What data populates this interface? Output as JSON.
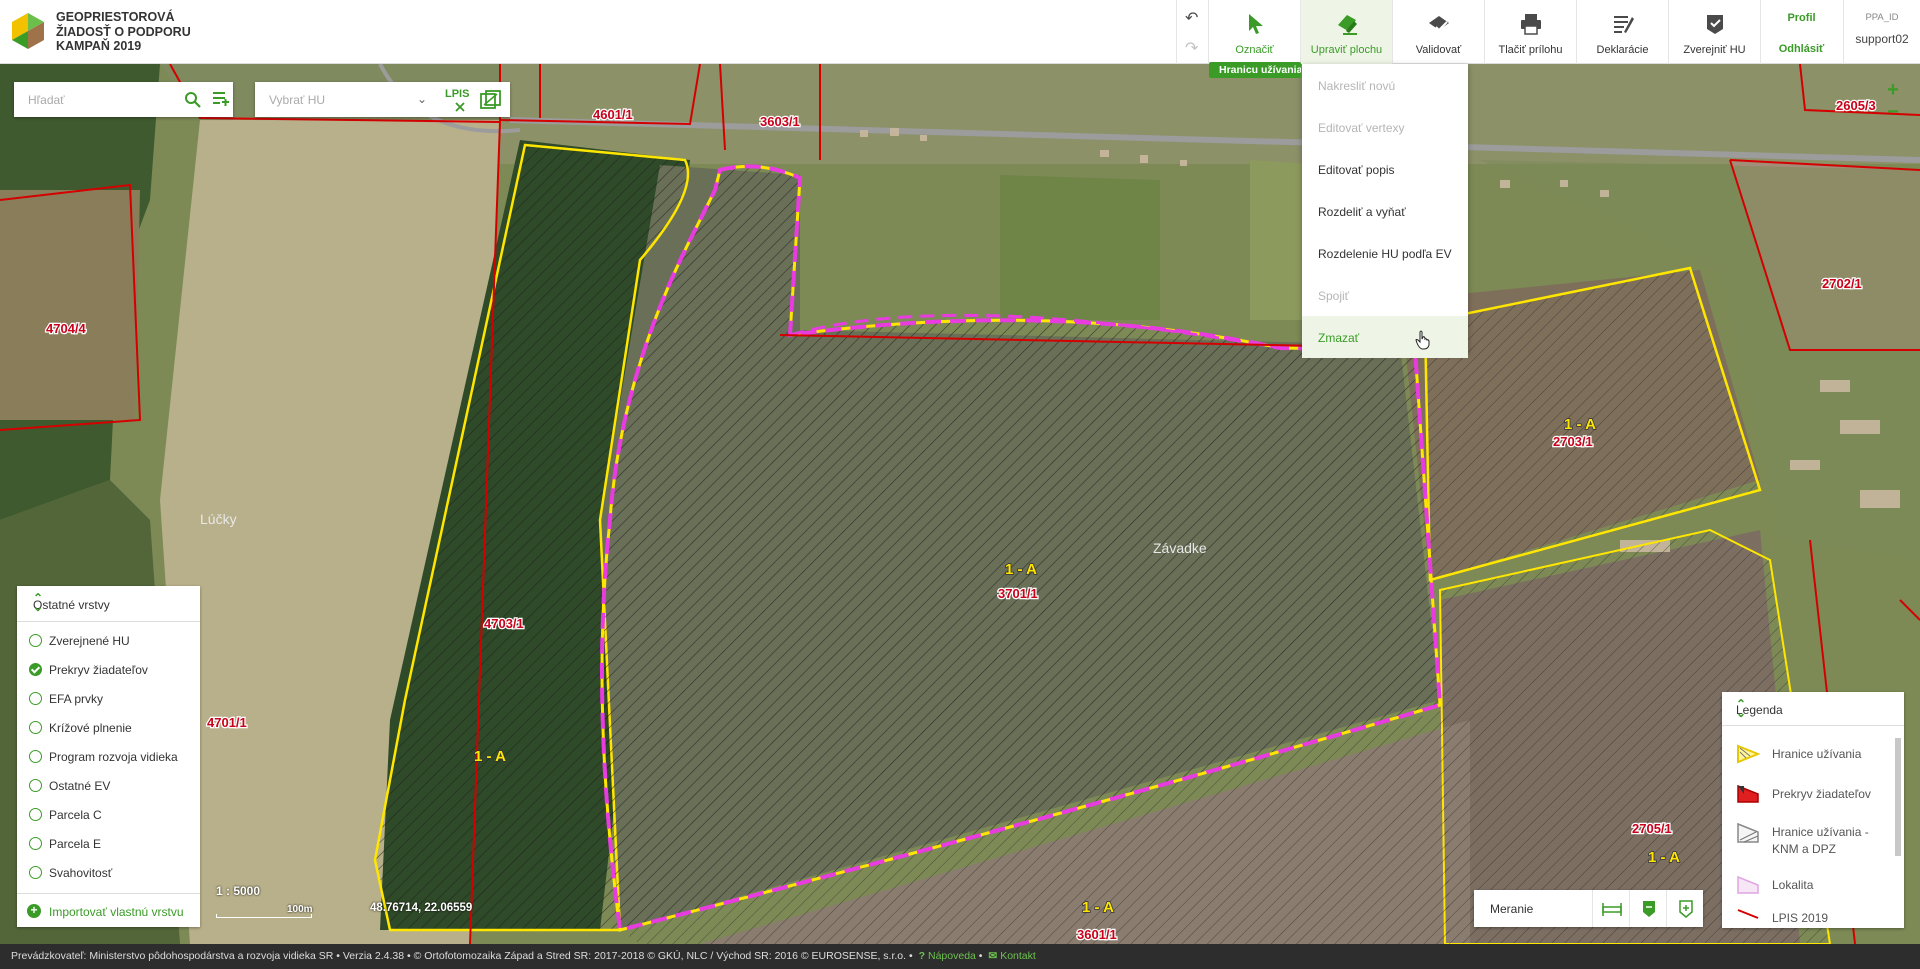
{
  "header": {
    "brand_line1": "GEOPRIESTOROVÁ",
    "brand_line2": "ŽIADOSŤ O PODPORU",
    "brand_line3": "KAMPAŇ 2019",
    "tools": [
      {
        "label": "Označiť",
        "icon": "cursor-icon"
      },
      {
        "label": "Upraviť plochu",
        "icon": "edit-area-icon"
      },
      {
        "label": "Validovať",
        "icon": "validate-icon"
      },
      {
        "label": "Tlačiť prílohu",
        "icon": "print-icon"
      },
      {
        "label": "Deklarácie",
        "icon": "declarations-icon"
      },
      {
        "label": "Zverejniť HU",
        "icon": "publish-icon"
      }
    ],
    "tooltip": "Hranicu užívania",
    "profile_label": "Profil",
    "logout_label": "Odhlásiť",
    "user_id_label": "PPA_ID",
    "username": "support02"
  },
  "search": {
    "placeholder": "Hľadať",
    "hu_placeholder": "Vybrať HU",
    "lpis_label": "LPIS"
  },
  "edit_menu": {
    "items": [
      {
        "label": "Nakresliť novú",
        "disabled": true
      },
      {
        "label": "Editovať vertexy",
        "disabled": true
      },
      {
        "label": "Editovať popis",
        "disabled": false
      },
      {
        "label": "Rozdeliť a vyňať",
        "disabled": false
      },
      {
        "label": "Rozdelenie HU podľa EV",
        "disabled": false
      },
      {
        "label": "Spojiť",
        "disabled": true
      },
      {
        "label": "Zmazať",
        "disabled": false,
        "hover": true
      }
    ]
  },
  "layers": {
    "title": "Ostatné vrstvy",
    "items": [
      {
        "label": "Zverejnené HU",
        "checked": false
      },
      {
        "label": "Prekryv žiadateľov",
        "checked": true
      },
      {
        "label": "EFA prvky",
        "checked": false
      },
      {
        "label": "Krížové plnenie",
        "checked": false
      },
      {
        "label": "Program rozvoja vidieka",
        "checked": false
      },
      {
        "label": "Ostatné EV",
        "checked": false
      },
      {
        "label": "Parcela C",
        "checked": false
      },
      {
        "label": "Parcela E",
        "checked": false
      },
      {
        "label": "Svahovitosť",
        "checked": false
      }
    ],
    "import_label": "Importovať vlastnú vrstvu"
  },
  "legend": {
    "title": "Legenda",
    "items": [
      {
        "label": "Hranice užívania"
      },
      {
        "label": "Prekryv žiadateľov"
      },
      {
        "label": "Hranice užívania - KNM a DPZ"
      },
      {
        "label": "Lokalita"
      },
      {
        "label": "LPIS 2019"
      }
    ]
  },
  "measure": {
    "label": "Meranie"
  },
  "map": {
    "scale": "1 : 5000",
    "scale_bar_label": "100m",
    "coordinates": "48.76714, 22.06559",
    "labels": {
      "p4601": "4601/1",
      "p3603": "3603/1",
      "p2605": "2605/3",
      "p2702": "2702/1",
      "p4704": "4704/4",
      "p2703": "2703/1",
      "p4703": "4703/1",
      "p3701": "3701/1",
      "p4701": "4701/1",
      "p2705": "2705/1",
      "p3601": "3601/1",
      "luky": "Lúčky",
      "zavadke": "Závadke",
      "a1": "1 - A",
      "a2": "1 - A",
      "a3": "1 - A",
      "a4": "1 - A",
      "a5": "1 - A"
    }
  },
  "footer": {
    "text": "Prevádzkovateľ: Ministerstvo pôdohospodárstva a rozvoja vidieka SR • Verzia 2.4.38 • © Ortofotomozaika Západ a Stred SR: 2017-2018 © GKÚ, NLC / Východ SR: 2016 © EUROSENSE, s.r.o. •",
    "help": "Nápoveda",
    "contact": "Kontakt"
  },
  "colors": {
    "accent": "#3a9b27",
    "parcel_border": "#d40000",
    "usage_border": "#ffe600",
    "selection_border": "#e83ce0"
  }
}
